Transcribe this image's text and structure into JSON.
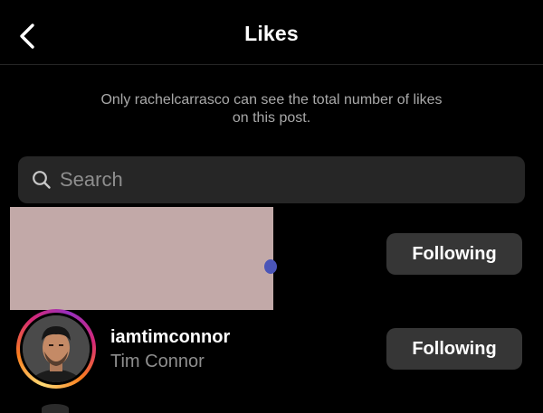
{
  "header": {
    "title": "Likes",
    "back_icon": "chevron-left-icon"
  },
  "notice": {
    "line1": "Only rachelcarrasco can see the total number of likes",
    "line2": "on this post."
  },
  "search": {
    "placeholder": "Search",
    "value": "",
    "icon": "search-icon"
  },
  "likes": [
    {
      "redacted": true,
      "button_label": "Following"
    },
    {
      "username": "iamtimconnor",
      "full_name": "Tim Connor",
      "has_story_ring": true,
      "button_label": "Following"
    }
  ],
  "colors": {
    "background": "#000000",
    "button_bg": "#363636",
    "search_bg": "#262626",
    "secondary_text": "#8e8e8e",
    "redaction": "#c2a9a8"
  }
}
